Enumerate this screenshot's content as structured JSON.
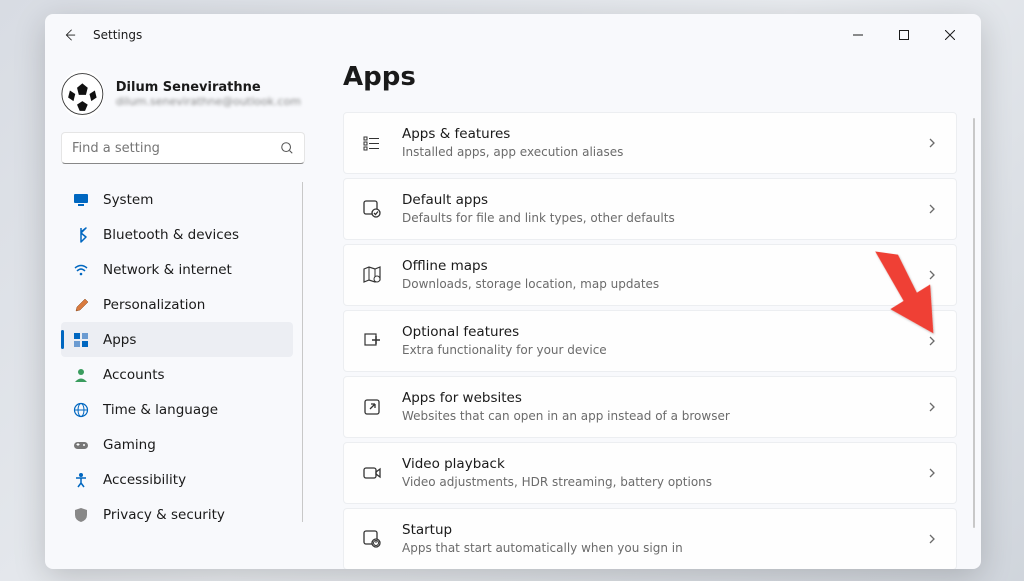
{
  "titlebar": {
    "title": "Settings"
  },
  "profile": {
    "name": "Dilum Senevirathne",
    "email": "dilum.senevirathne@outlook.com"
  },
  "search": {
    "placeholder": "Find a setting"
  },
  "nav": {
    "items": [
      {
        "label": "System"
      },
      {
        "label": "Bluetooth & devices"
      },
      {
        "label": "Network & internet"
      },
      {
        "label": "Personalization"
      },
      {
        "label": "Apps"
      },
      {
        "label": "Accounts"
      },
      {
        "label": "Time & language"
      },
      {
        "label": "Gaming"
      },
      {
        "label": "Accessibility"
      },
      {
        "label": "Privacy & security"
      }
    ],
    "active_index": 4
  },
  "page": {
    "title": "Apps"
  },
  "cards": [
    {
      "title": "Apps & features",
      "subtitle": "Installed apps, app execution aliases"
    },
    {
      "title": "Default apps",
      "subtitle": "Defaults for file and link types, other defaults"
    },
    {
      "title": "Offline maps",
      "subtitle": "Downloads, storage location, map updates"
    },
    {
      "title": "Optional features",
      "subtitle": "Extra functionality for your device"
    },
    {
      "title": "Apps for websites",
      "subtitle": "Websites that can open in an app instead of a browser"
    },
    {
      "title": "Video playback",
      "subtitle": "Video adjustments, HDR streaming, battery options"
    },
    {
      "title": "Startup",
      "subtitle": "Apps that start automatically when you sign in"
    }
  ],
  "icons": {
    "nav": [
      "monitor-icon",
      "bluetooth-icon",
      "wifi-icon",
      "brush-icon",
      "apps-icon",
      "person-icon",
      "globe-icon",
      "gamepad-icon",
      "accessibility-icon",
      "shield-icon"
    ],
    "cards": [
      "list-icon",
      "default-app-icon",
      "map-icon",
      "plus-tile-icon",
      "open-external-icon",
      "video-icon",
      "startup-icon"
    ]
  },
  "colors": {
    "accent": "#0067c0",
    "arrow": "#ef4136"
  }
}
